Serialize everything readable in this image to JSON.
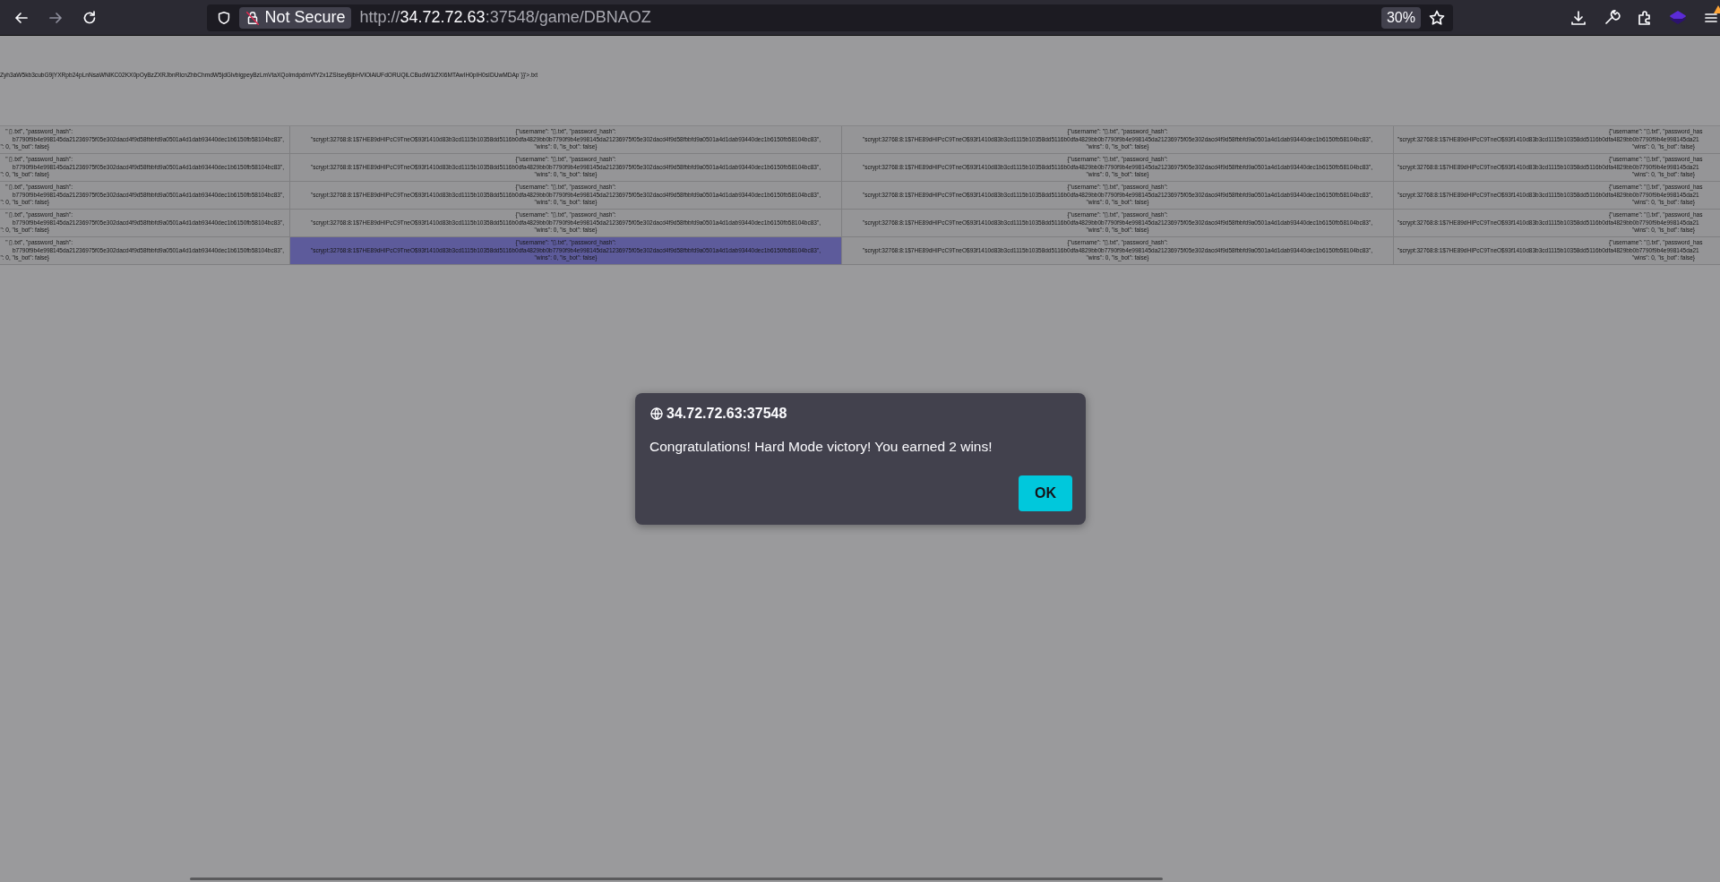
{
  "toolbar": {
    "forward_button": {
      "disabled": true
    },
    "security_label": "Not Secure",
    "url": {
      "scheme": "http://",
      "host": "34.72.72.63",
      "rest": ":37548/game/DBNAOZ"
    },
    "zoom": "30%",
    "menu_badge": true
  },
  "page": {
    "heading_text": "Zyh3aW5kb3cubG9jYXRpb24pLnNsaWNlKC02KX0pOyBzZXRJbnRlcnZhbChmdW5jdGlvbigpeyBzLmVtaXQoImdpdmVfY2x1ZSIseyBjbHVlOiAiUFdORUQiLCBudW1iZXI6MTAwIH0pIH0sIDUwMDAp`}}'>.txt",
    "table": {
      "rows": [
        {
          "cells": [
            {
              "lines": [
                "\" ▯.txt\", \"password_hash\":",
                "b7790f9b4e998145da21236975f05e302dacd4f9d58fbbfd9a0501a4d1dab93440dec1b6150fb58104bc83\",",
                "\": 0, \"is_bot\": false}"
              ],
              "selected": false
            },
            {
              "lines": [
                "{\"username\": \"▯.txt\", \"password_hash\":",
                "\"scrypt:32768:8:1$7HE89dHIPcC9TneO$93f1410d83b3cd1115b10358dd5116b0dfa4829bb0b7790f9b4e998145da21236975f05e302dacd4f9d58fbbfd9a0501a4d1dab93440dec1b6150fb58104bc83\",",
                "\"wins\": 0, \"is_bot\": false}"
              ],
              "selected": false
            },
            {
              "lines": [
                "{\"username\": \"▯.txt\", \"password_hash\":",
                "\"scrypt:32768:8:1$7HE89dHIPcC9TneO$93f1410d83b3cd1115b10358dd5116b0dfa4829bb0b7790f9b4e998145da21236975f05e302dacd4f9d58fbbfd9a0501a4d1dab93440dec1b6150fb58104bc83\",",
                "\"wins\": 0, \"is_bot\": false}"
              ],
              "selected": false
            },
            {
              "lines": [
                "{\"username\": \"▯.txt\", \"password_has",
                "\"scrypt:32768:8:1$7HE89dHIPcC9TneO$93f1410d83b3cd1115b10358dd5116b0dfa4829bb0b7790f9b4e998145da21",
                "\"wins\": 0, \"is_bot\": false}"
              ],
              "selected": false
            }
          ]
        },
        {
          "cells": [
            {
              "lines": [
                "\" ▯.txt\", \"password_hash\":",
                "b7790f9b4e998145da21236975f05e302dacd4f9d58fbbfd9a0501a4d1dab93440dec1b6150fb58104bc83\",",
                "\": 0, \"is_bot\": false}"
              ],
              "selected": false
            },
            {
              "lines": [
                "{\"username\": \"▯.txt\", \"password_hash\":",
                "\"scrypt:32768:8:1$7HE89dHIPcC9TneO$93f1410d83b3cd1115b10358dd5116b0dfa4829bb0b7790f9b4e998145da21236975f05e302dacd4f9d58fbbfd9a0501a4d1dab93440dec1b6150fb58104bc83\",",
                "\"wins\": 0, \"is_bot\": false}"
              ],
              "selected": false
            },
            {
              "lines": [
                "{\"username\": \"▯.txt\", \"password_hash\":",
                "\"scrypt:32768:8:1$7HE89dHIPcC9TneO$93f1410d83b3cd1115b10358dd5116b0dfa4829bb0b7790f9b4e998145da21236975f05e302dacd4f9d58fbbfd9a0501a4d1dab93440dec1b6150fb58104bc83\",",
                "\"wins\": 0, \"is_bot\": false}"
              ],
              "selected": false
            },
            {
              "lines": [
                "{\"username\": \"▯.txt\", \"password_has",
                "\"scrypt:32768:8:1$7HE89dHIPcC9TneO$93f1410d83b3cd1115b10358dd5116b0dfa4829bb0b7790f9b4e998145da21",
                "\"wins\": 0, \"is_bot\": false}"
              ],
              "selected": false
            }
          ]
        },
        {
          "cells": [
            {
              "lines": [
                "\" ▯.txt\", \"password_hash\":",
                "b7790f9b4e998145da21236975f05e302dacd4f9d58fbbfd9a0501a4d1dab93440dec1b6150fb58104bc83\",",
                "\": 0, \"is_bot\": false}"
              ],
              "selected": false
            },
            {
              "lines": [
                "{\"username\": \"▯.txt\", \"password_hash\":",
                "\"scrypt:32768:8:1$7HE89dHIPcC9TneO$93f1410d83b3cd1115b10358dd5116b0dfa4829bb0b7790f9b4e998145da21236975f05e302dacd4f9d58fbbfd9a0501a4d1dab93440dec1b6150fb58104bc83\",",
                "\"wins\": 0, \"is_bot\": false}"
              ],
              "selected": false
            },
            {
              "lines": [
                "{\"username\": \"▯.txt\", \"password_hash\":",
                "\"scrypt:32768:8:1$7HE89dHIPcC9TneO$93f1410d83b3cd1115b10358dd5116b0dfa4829bb0b7790f9b4e998145da21236975f05e302dacd4f9d58fbbfd9a0501a4d1dab93440dec1b6150fb58104bc83\",",
                "\"wins\": 0, \"is_bot\": false}"
              ],
              "selected": false
            },
            {
              "lines": [
                "{\"username\": \"▯.txt\", \"password_has",
                "\"scrypt:32768:8:1$7HE89dHIPcC9TneO$93f1410d83b3cd1115b10358dd5116b0dfa4829bb0b7790f9b4e998145da21",
                "\"wins\": 0, \"is_bot\": false}"
              ],
              "selected": false
            }
          ]
        },
        {
          "cells": [
            {
              "lines": [
                "\" ▯.txt\", \"password_hash\":",
                "b7790f9b4e998145da21236975f05e302dacd4f9d58fbbfd9a0501a4d1dab93440dec1b6150fb58104bc83\",",
                "\": 0, \"is_bot\": false}"
              ],
              "selected": false
            },
            {
              "lines": [
                "{\"username\": \"▯.txt\", \"password_hash\":",
                "\"scrypt:32768:8:1$7HE89dHIPcC9TneO$93f1410d83b3cd1115b10358dd5116b0dfa4829bb0b7790f9b4e998145da21236975f05e302dacd4f9d58fbbfd9a0501a4d1dab93440dec1b6150fb58104bc83\",",
                "\"wins\": 0, \"is_bot\": false}"
              ],
              "selected": false
            },
            {
              "lines": [
                "{\"username\": \"▯.txt\", \"password_hash\":",
                "\"scrypt:32768:8:1$7HE89dHIPcC9TneO$93f1410d83b3cd1115b10358dd5116b0dfa4829bb0b7790f9b4e998145da21236975f05e302dacd4f9d58fbbfd9a0501a4d1dab93440dec1b6150fb58104bc83\",",
                "\"wins\": 0, \"is_bot\": false}"
              ],
              "selected": false
            },
            {
              "lines": [
                "{\"username\": \"▯.txt\", \"password_has",
                "\"scrypt:32768:8:1$7HE89dHIPcC9TneO$93f1410d83b3cd1115b10358dd5116b0dfa4829bb0b7790f9b4e998145da21",
                "\"wins\": 0, \"is_bot\": false}"
              ],
              "selected": false
            }
          ]
        },
        {
          "cells": [
            {
              "lines": [
                "\" ▯.txt\", \"password_hash\":",
                "b7790f9b4e998145da21236975f05e302dacd4f9d58fbbfd9a0501a4d1dab93440dec1b6150fb58104bc83\",",
                "\": 0, \"is_bot\": false}"
              ],
              "selected": false
            },
            {
              "lines": [
                "{\"username\": \"▯.txt\", \"password_hash\":",
                "\"scrypt:32768:8:1$7HE89dHIPcC9TneO$93f1410d83b3cd1115b10358dd5116b0dfa4829bb0b7790f9b4e998145da21236975f05e302dacd4f9d58fbbfd9a0501a4d1dab93440dec1b6150fb58104bc83\",",
                "\"wins\": 0, \"is_bot\": false}"
              ],
              "selected": true
            },
            {
              "lines": [
                "{\"username\": \"▯.txt\", \"password_hash\":",
                "\"scrypt:32768:8:1$7HE89dHIPcC9TneO$93f1410d83b3cd1115b10358dd5116b0dfa4829bb0b7790f9b4e998145da21236975f05e302dacd4f9d58fbbfd9a0501a4d1dab93440dec1b6150fb58104bc83\",",
                "\"wins\": 0, \"is_bot\": false}"
              ],
              "selected": false
            },
            {
              "lines": [
                "{\"username\": \"▯.txt\", \"password_has",
                "\"scrypt:32768:8:1$7HE89dHIPcC9TneO$93f1410d83b3cd1115b10358dd5116b0dfa4829bb0b7790f9b4e998145da21",
                "\"wins\": 0, \"is_bot\": false}"
              ],
              "selected": false
            }
          ]
        }
      ]
    }
  },
  "dialog": {
    "origin": "34.72.72.63:37548",
    "message": "Congratulations! Hard Mode victory! You earned 2 wins!",
    "button": "OK"
  }
}
